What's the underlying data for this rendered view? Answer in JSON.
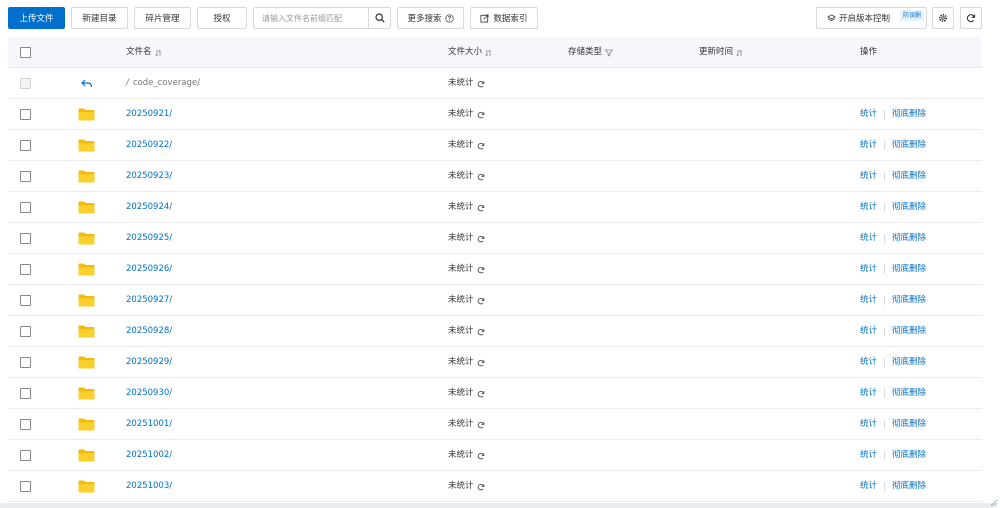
{
  "toolbar": {
    "upload": "上传文件",
    "new_dir": "新建目录",
    "fragments": "碎片管理",
    "authorize": "授权",
    "search_placeholder": "请输入文件名前缀匹配",
    "more_search": "更多搜索",
    "data_index": "数据索引",
    "versioning": "开启版本控制",
    "versioning_tag": "防误删"
  },
  "columns": {
    "name": "文件名",
    "size": "文件大小",
    "storage": "存储类型",
    "updated": "更新时间",
    "actions": "操作"
  },
  "parent": {
    "name": "code_coverage/",
    "size": "未统计"
  },
  "rows": [
    {
      "name": "20250921/",
      "size": "未统计",
      "op1": "统计",
      "op2": "彻底删除"
    },
    {
      "name": "20250922/",
      "size": "未统计",
      "op1": "统计",
      "op2": "彻底删除"
    },
    {
      "name": "20250923/",
      "size": "未统计",
      "op1": "统计",
      "op2": "彻底删除"
    },
    {
      "name": "20250924/",
      "size": "未统计",
      "op1": "统计",
      "op2": "彻底删除"
    },
    {
      "name": "20250925/",
      "size": "未统计",
      "op1": "统计",
      "op2": "彻底删除"
    },
    {
      "name": "20250926/",
      "size": "未统计",
      "op1": "统计",
      "op2": "彻底删除"
    },
    {
      "name": "20250927/",
      "size": "未统计",
      "op1": "统计",
      "op2": "彻底删除"
    },
    {
      "name": "20250928/",
      "size": "未统计",
      "op1": "统计",
      "op2": "彻底删除"
    },
    {
      "name": "20250929/",
      "size": "未统计",
      "op1": "统计",
      "op2": "彻底删除"
    },
    {
      "name": "20250930/",
      "size": "未统计",
      "op1": "统计",
      "op2": "彻底删除"
    },
    {
      "name": "20251001/",
      "size": "未统计",
      "op1": "统计",
      "op2": "彻底删除"
    },
    {
      "name": "20251002/",
      "size": "未统计",
      "op1": "统计",
      "op2": "彻底删除"
    },
    {
      "name": "20251003/",
      "size": "未统计",
      "op1": "统计",
      "op2": "彻底删除"
    }
  ],
  "colors": {
    "accent": "#0070cc",
    "folder": "#f5c518"
  }
}
